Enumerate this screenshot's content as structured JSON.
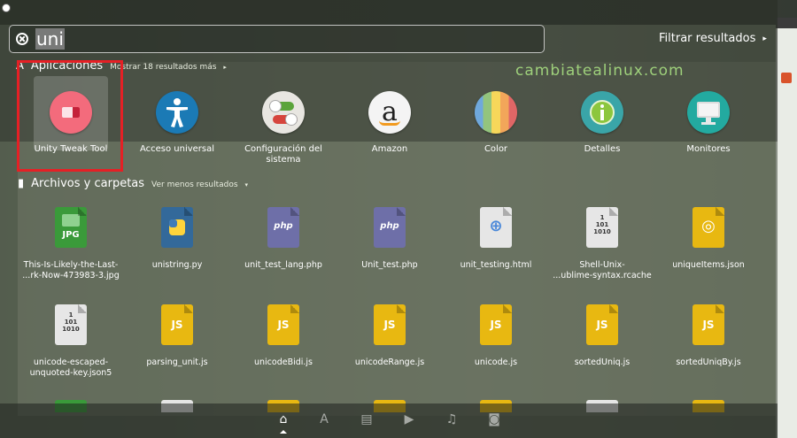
{
  "search": {
    "query": "uni",
    "filter_label": "Filtrar resultados",
    "filter_arrow": "▸"
  },
  "watermark": "cambiatealinux.com",
  "applications": {
    "title": "Aplicaciones",
    "more_label": "Mostrar 18 resultados más",
    "arrow": "▸",
    "items": [
      {
        "label": "Unity Tweak Tool",
        "icon": "unity-tweak-tool-icon"
      },
      {
        "label": "Acceso universal",
        "icon": "accessibility-icon"
      },
      {
        "label": "Configuración del sistema",
        "icon": "system-settings-icon"
      },
      {
        "label": "Amazon",
        "icon": "amazon-icon"
      },
      {
        "label": "Color",
        "icon": "color-icon"
      },
      {
        "label": "Detalles",
        "icon": "details-icon"
      },
      {
        "label": "Monitores",
        "icon": "monitor-icon"
      }
    ]
  },
  "files": {
    "title": "Archivos y carpetas",
    "less_label": "Ver menos resultados",
    "arrow": "▾",
    "items": [
      {
        "label": "This-Is-Likely-the-Last-\n...rk-Now-473983-3.jpg",
        "type": "jpg",
        "icon_text": "JPG"
      },
      {
        "label": "unistring.py",
        "type": "python",
        "icon_text": "py"
      },
      {
        "label": "unit_test_lang.php",
        "type": "php",
        "icon_text": "php"
      },
      {
        "label": "Unit_test.php",
        "type": "php",
        "icon_text": "php"
      },
      {
        "label": "unit_testing.html",
        "type": "html",
        "icon_text": "⊕"
      },
      {
        "label": "Shell-Unix-\n...ublime-syntax.rcache",
        "type": "binary",
        "icon_text": "1\n101\n1010"
      },
      {
        "label": "uniqueItems.json",
        "type": "json",
        "icon_text": "◎"
      },
      {
        "label": "unicode-escaped-\nunquoted-key.json5",
        "type": "binary",
        "icon_text": "1\n101\n1010"
      },
      {
        "label": "parsing_unit.js",
        "type": "js",
        "icon_text": "JS"
      },
      {
        "label": "unicodeBidi.js",
        "type": "js",
        "icon_text": "JS"
      },
      {
        "label": "unicodeRange.js",
        "type": "js",
        "icon_text": "JS"
      },
      {
        "label": "unicode.js",
        "type": "js",
        "icon_text": "JS"
      },
      {
        "label": "sortedUniq.js",
        "type": "js",
        "icon_text": "JS"
      },
      {
        "label": "sortedUniqBy.js",
        "type": "js",
        "icon_text": "JS"
      }
    ]
  },
  "lenses": [
    {
      "name": "home-lens",
      "glyph": "⌂"
    },
    {
      "name": "applications-lens",
      "glyph": "A"
    },
    {
      "name": "files-lens",
      "glyph": "▤"
    },
    {
      "name": "video-lens",
      "glyph": "▶"
    },
    {
      "name": "music-lens",
      "glyph": "♫"
    },
    {
      "name": "photo-lens",
      "glyph": "◙"
    }
  ],
  "colors": {
    "highlight_border": "#e52025",
    "watermark": "#9ed07b",
    "php": "#6e6fa8",
    "js": "#e8b811",
    "jpg": "#3a9a3a",
    "python": "#33699a",
    "html": "#e6e6e6",
    "binary": "#e6e6e6",
    "json": "#e8b811"
  }
}
